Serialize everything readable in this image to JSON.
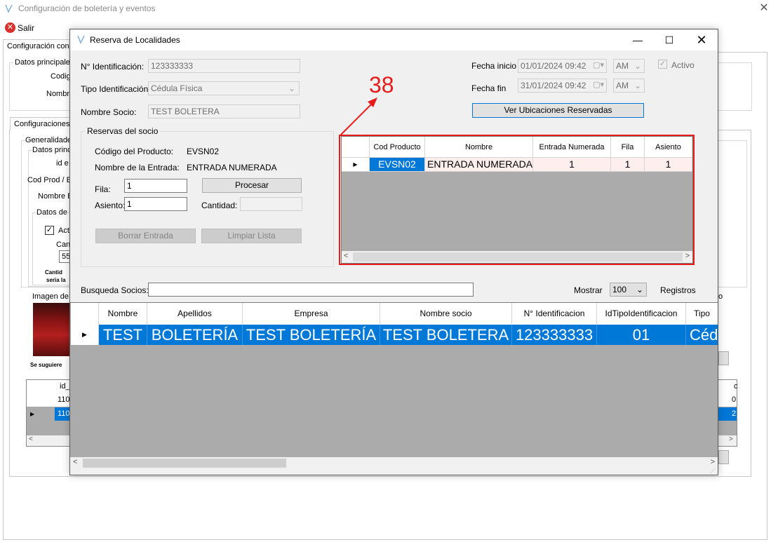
{
  "background_window": {
    "title": "Configuración de boletería y eventos",
    "close_glyph": "✕",
    "toolbar": {
      "salir_label": "Salir"
    },
    "tab_main": "Configuración cont",
    "group_datos_principales": "Datos principales",
    "label_codig": "Codig",
    "label_nombre": "Nombre",
    "tab_config": "Configuraciones",
    "generalidades": "Generalidade",
    "datos_princ": "Datos princ",
    "id_e": "id e",
    "cod_prod": "Cod Prod / E",
    "nombre_b": "Nombre E",
    "datos_de": "Datos de",
    "check_glyph": "✓",
    "act": "Act",
    "can": "Can",
    "value_55": "55",
    "cantid_note": "Cantid",
    "seria_note": "seria la",
    "imagen_de": "Imagen de",
    "se_sugiere": "Se suguiere",
    "grid_id_header": "id_",
    "grid_row1": "110",
    "grid_row2": "110",
    "right_o": "o",
    "right_grid_c": "c",
    "right_grid_0": "0",
    "right_grid_2": "2"
  },
  "dialog": {
    "title": "Reserva de Localidades",
    "minimize_glyph": "—",
    "maximize_glyph": "☐",
    "close_glyph": "✕",
    "identificacion_label": "N° Identificación:",
    "identificacion_value": "123333333",
    "tipo_label": "Tipo Identificación:",
    "tipo_value": "Cédula Física",
    "nombre_socio_label": "Nombre Socio:",
    "nombre_socio_value": "TEST BOLETERA",
    "fecha_inicio_label": "Fecha inicio",
    "fecha_inicio_value": "01/01/2024 09:42",
    "fecha_inicio_ampm": "AM",
    "fecha_fin_label": "Fecha fin",
    "fecha_fin_value": "31/01/2024 09:42",
    "fecha_fin_ampm": "AM",
    "activo_label": "Activo",
    "ver_ubicaciones_button": "Ver Ubicaciones Reservadas",
    "reservas_group_title": "Reservas del socio",
    "codigo_producto_label": "Código del Producto:",
    "codigo_producto_value": "EVSN02",
    "nombre_entrada_label": "Nombre de la Entrada:",
    "nombre_entrada_value": "ENTRADA NUMERADA",
    "fila_label": "Fila:",
    "fila_value": "1",
    "asiento_label": "Asiento:",
    "asiento_value": "1",
    "cantidad_label": "Cantidad:",
    "cantidad_value": "",
    "procesar_button": "Procesar",
    "borrar_entrada_button": "Borrar Entrada",
    "limpiar_lista_button": "Limpiar Lista",
    "reservas_grid": {
      "headers": [
        "Cod Producto",
        "Nombre",
        "Entrada Numerada",
        "Fila",
        "Asiento"
      ],
      "rows": [
        {
          "cod": "EVSN02",
          "nombre": "ENTRADA NUMERADA",
          "entrada_numerada": "1",
          "fila": "1",
          "asiento": "1"
        }
      ]
    },
    "busqueda_label": "Busqueda Socios:",
    "busqueda_value": "",
    "mostrar_label": "Mostrar",
    "mostrar_value": "100",
    "registros_label": "Registros",
    "socios_grid": {
      "headers": [
        "Nombre",
        "Apellidos",
        "Empresa",
        "Nombre socio",
        "N° Identificacion",
        "IdTipoIdentificacion",
        "Tipo"
      ],
      "rows": [
        {
          "nombre": "TEST",
          "apellidos": "BOLETERÍA",
          "empresa": "TEST BOLETERÍA",
          "nombre_socio": "TEST BOLETERA",
          "identificacion": "123333333",
          "id_tipo": "01",
          "tipo": "Céd"
        }
      ]
    }
  },
  "annotation": {
    "number": "38",
    "color": "#e81b1b"
  },
  "colors": {
    "selection": "#0078d7",
    "highlight_border": "#e81b1b",
    "grid_empty": "#ababab"
  }
}
